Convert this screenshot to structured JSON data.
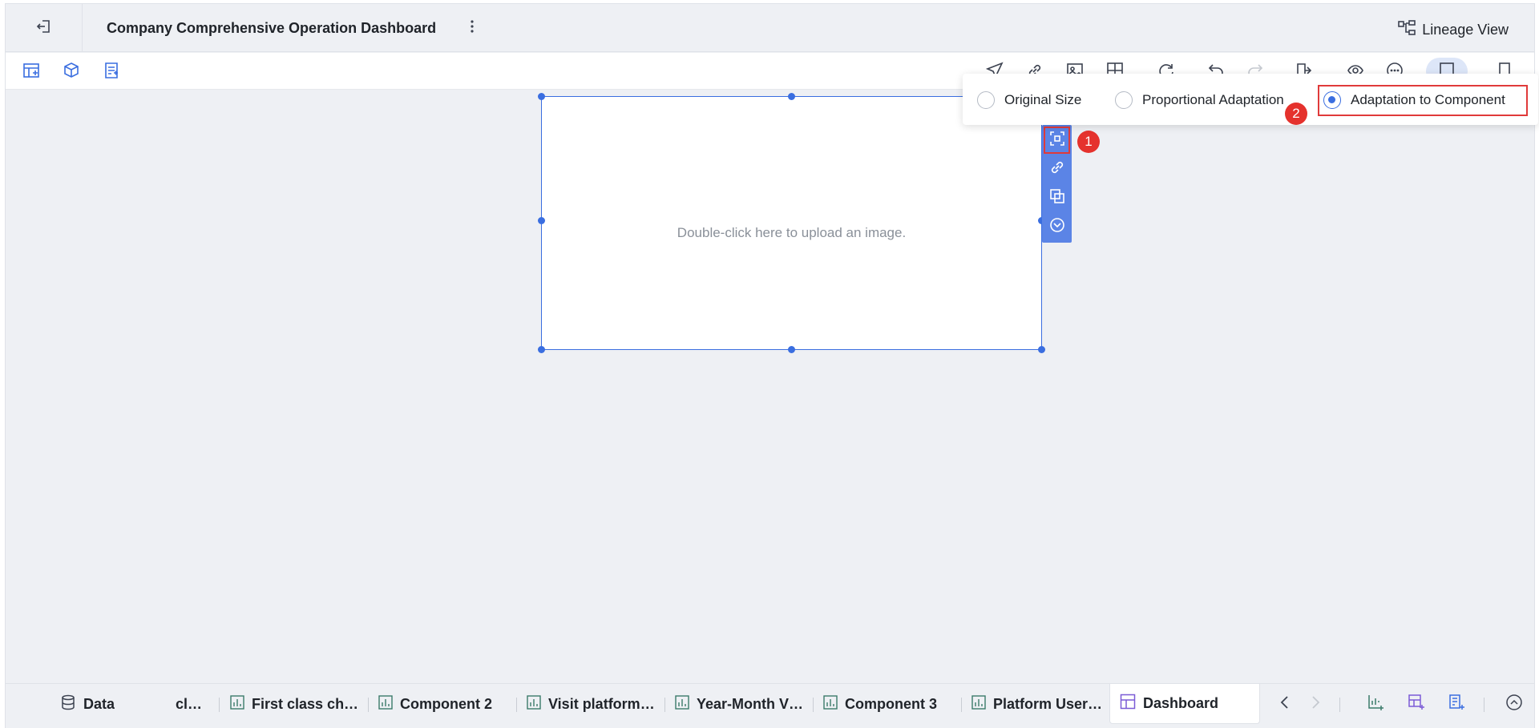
{
  "header": {
    "title": "Company Comprehensive Operation Dashboard",
    "lineage_label": "Lineage View"
  },
  "toolbar": {
    "left_icons": [
      "add-component-icon",
      "add-dataset-icon",
      "add-report-icon"
    ],
    "right_icons": [
      "send-icon",
      "link-icon",
      "image-icon",
      "grid-icon",
      "refresh-icon",
      "undo-icon",
      "redo-icon",
      "export-icon",
      "preview-icon",
      "more-icon",
      "layout-icon",
      "mobile-icon"
    ]
  },
  "canvas": {
    "upload_hint": "Double-click here to upload an image."
  },
  "image_fit_menu": {
    "options": [
      {
        "label": "Original Size",
        "selected": false
      },
      {
        "label": "Proportional Adaptation",
        "selected": false
      },
      {
        "label": "Adaptation to Component",
        "selected": true
      }
    ]
  },
  "callouts": [
    "1",
    "2"
  ],
  "bottom_tabs": [
    {
      "label": "Data",
      "icon": "database-icon"
    },
    {
      "label": "cl…",
      "icon": ""
    },
    {
      "label": "First class ch…",
      "icon": "chart-icon"
    },
    {
      "label": "Component 2",
      "icon": "chart-icon"
    },
    {
      "label": "Visit platform…",
      "icon": "chart-icon"
    },
    {
      "label": "Year-Month V…",
      "icon": "chart-icon"
    },
    {
      "label": "Component 3",
      "icon": "chart-icon"
    },
    {
      "label": "Platform User…",
      "icon": "chart-icon"
    },
    {
      "label": "Dashboard",
      "icon": "dashboard-icon",
      "active": true
    }
  ],
  "colors": {
    "accent": "#3a6ee0",
    "callout": "#e5322d",
    "canvas_bg": "#eef0f4"
  }
}
